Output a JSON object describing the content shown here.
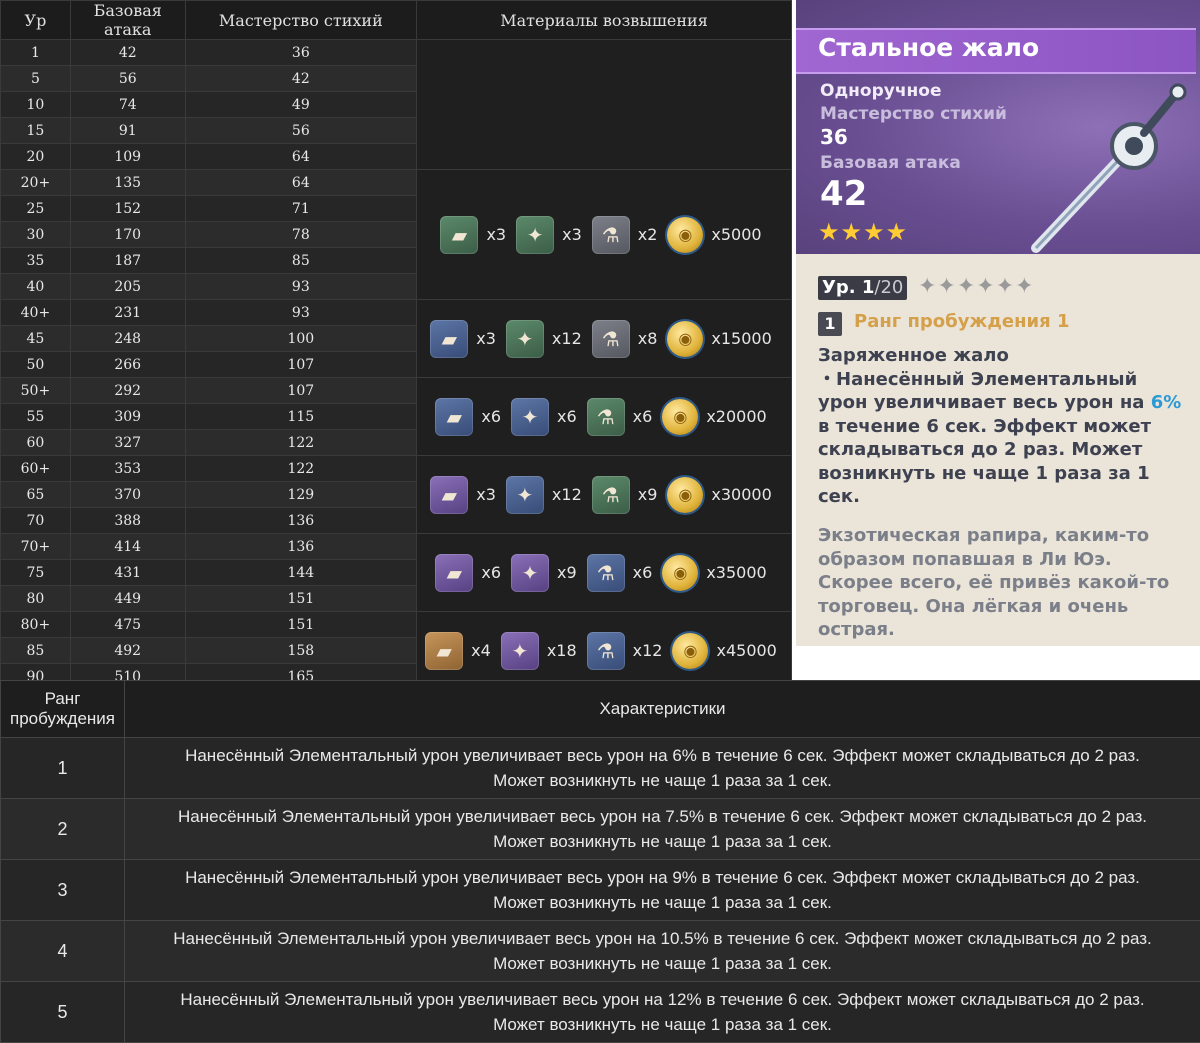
{
  "stats_table": {
    "headers": [
      "Ур",
      "Базовая атака",
      "Мастерство стихий",
      "Материалы возвышения"
    ],
    "rows": [
      {
        "level": "1",
        "atk": "42",
        "em": "36"
      },
      {
        "level": "5",
        "atk": "56",
        "em": "42"
      },
      {
        "level": "10",
        "atk": "74",
        "em": "49"
      },
      {
        "level": "15",
        "atk": "91",
        "em": "56"
      },
      {
        "level": "20",
        "atk": "109",
        "em": "64"
      },
      {
        "level": "20+",
        "atk": "135",
        "em": "64"
      },
      {
        "level": "25",
        "atk": "152",
        "em": "71"
      },
      {
        "level": "30",
        "atk": "170",
        "em": "78"
      },
      {
        "level": "35",
        "atk": "187",
        "em": "85"
      },
      {
        "level": "40",
        "atk": "205",
        "em": "93"
      },
      {
        "level": "40+",
        "atk": "231",
        "em": "93"
      },
      {
        "level": "45",
        "atk": "248",
        "em": "100"
      },
      {
        "level": "50",
        "atk": "266",
        "em": "107"
      },
      {
        "level": "50+",
        "atk": "292",
        "em": "107"
      },
      {
        "level": "55",
        "atk": "309",
        "em": "115"
      },
      {
        "level": "60",
        "atk": "327",
        "em": "122"
      },
      {
        "level": "60+",
        "atk": "353",
        "em": "122"
      },
      {
        "level": "65",
        "atk": "370",
        "em": "129"
      },
      {
        "level": "70",
        "atk": "388",
        "em": "136"
      },
      {
        "level": "70+",
        "atk": "414",
        "em": "136"
      },
      {
        "level": "75",
        "atk": "431",
        "em": "144"
      },
      {
        "level": "80",
        "atk": "449",
        "em": "151"
      },
      {
        "level": "80+",
        "atk": "475",
        "em": "151"
      },
      {
        "level": "85",
        "atk": "492",
        "em": "158"
      },
      {
        "level": "90",
        "atk": "510",
        "em": "165"
      }
    ],
    "materials": [
      {
        "items": [
          {
            "icon": "weapon-material-icon",
            "rarity": "r2",
            "glyph": "▰",
            "count": "x3"
          },
          {
            "icon": "elite-drop-icon",
            "rarity": "r2",
            "glyph": "✦",
            "count": "x3"
          },
          {
            "icon": "common-drop-icon",
            "rarity": "r1",
            "glyph": "⚗",
            "count": "x2"
          },
          {
            "icon": "mora-icon",
            "rarity": "mora",
            "glyph": "◉",
            "count": "x5000"
          }
        ]
      },
      {
        "items": [
          {
            "icon": "weapon-material-icon",
            "rarity": "r3",
            "glyph": "▰",
            "count": "x3"
          },
          {
            "icon": "elite-drop-icon",
            "rarity": "r2",
            "glyph": "✦",
            "count": "x12"
          },
          {
            "icon": "common-drop-icon",
            "rarity": "r1",
            "glyph": "⚗",
            "count": "x8"
          },
          {
            "icon": "mora-icon",
            "rarity": "mora",
            "glyph": "◉",
            "count": "x15000"
          }
        ]
      },
      {
        "items": [
          {
            "icon": "weapon-material-icon",
            "rarity": "r3",
            "glyph": "▰",
            "count": "x6"
          },
          {
            "icon": "elite-drop-icon",
            "rarity": "r3",
            "glyph": "✦",
            "count": "x6"
          },
          {
            "icon": "common-drop-icon",
            "rarity": "r2",
            "glyph": "⚗",
            "count": "x6"
          },
          {
            "icon": "mora-icon",
            "rarity": "mora",
            "glyph": "◉",
            "count": "x20000"
          }
        ]
      },
      {
        "items": [
          {
            "icon": "weapon-material-icon",
            "rarity": "r4",
            "glyph": "▰",
            "count": "x3"
          },
          {
            "icon": "elite-drop-icon",
            "rarity": "r3",
            "glyph": "✦",
            "count": "x12"
          },
          {
            "icon": "common-drop-icon",
            "rarity": "r2",
            "glyph": "⚗",
            "count": "x9"
          },
          {
            "icon": "mora-icon",
            "rarity": "mora",
            "glyph": "◉",
            "count": "x30000"
          }
        ]
      },
      {
        "items": [
          {
            "icon": "weapon-material-icon",
            "rarity": "r4",
            "glyph": "▰",
            "count": "x6"
          },
          {
            "icon": "elite-drop-icon",
            "rarity": "r4",
            "glyph": "✦",
            "count": "x9"
          },
          {
            "icon": "common-drop-icon",
            "rarity": "r3",
            "glyph": "⚗",
            "count": "x6"
          },
          {
            "icon": "mora-icon",
            "rarity": "mora",
            "glyph": "◉",
            "count": "x35000"
          }
        ]
      },
      {
        "items": [
          {
            "icon": "weapon-material-icon",
            "rarity": "r5",
            "glyph": "▰",
            "count": "x4"
          },
          {
            "icon": "elite-drop-icon",
            "rarity": "r4",
            "glyph": "✦",
            "count": "x18"
          },
          {
            "icon": "common-drop-icon",
            "rarity": "r3",
            "glyph": "⚗",
            "count": "x12"
          },
          {
            "icon": "mora-icon",
            "rarity": "mora",
            "glyph": "◉",
            "count": "x45000"
          }
        ]
      }
    ]
  },
  "weapon_card": {
    "name": "Стальное жало",
    "type": "Одноручное",
    "substat_label": "Мастерство стихий",
    "substat_value": "36",
    "atk_label": "Базовая атака",
    "atk_value": "42",
    "rarity_stars": "★★★★",
    "level_prefix": "Ур. 1",
    "level_max": "/20",
    "refine_stars": "✦✦✦✦✦✦",
    "refine_number": "1",
    "refine_label": "Ранг пробуждения 1",
    "passive_name": "Заряженное жало",
    "passive_text_1": "・Нанесённый Элементальный урон увеличивает весь урон на ",
    "passive_highlight": "6%",
    "passive_text_2": " в течение 6 сек. Эффект может складываться до 2 раз. Может возникнуть не чаще 1 раза за 1 сек.",
    "lore": "Экзотическая рапира, каким-то образом попавшая в Ли Юэ. Скорее всего, её привёз какой-то торговец. Она лёгкая и очень острая.",
    "colors": {
      "title_bar": "#9a60cc",
      "highlight": "#2b9ad6",
      "refine_label": "#d5a04a",
      "star": "#ffcc33"
    }
  },
  "refine_table": {
    "header_rank": "Ранг пробуждения",
    "header_desc": "Характеристики",
    "rows": [
      {
        "rank": "1",
        "line1": "Нанесённый Элементальный урон увеличивает весь урон на 6% в течение 6 сек. Эффект может складываться до 2 раз.",
        "line2": "Может возникнуть не чаще 1 раза за 1 сек."
      },
      {
        "rank": "2",
        "line1": "Нанесённый Элементальный урон увеличивает весь урон на 7.5% в течение 6 сек. Эффект может складываться до 2 раз.",
        "line2": "Может возникнуть не чаще 1 раза за 1 сек."
      },
      {
        "rank": "3",
        "line1": "Нанесённый Элементальный урон увеличивает весь урон на 9% в течение 6 сек. Эффект может складываться до 2 раз.",
        "line2": "Может возникнуть не чаще 1 раза за 1 сек."
      },
      {
        "rank": "4",
        "line1": "Нанесённый Элементальный урон увеличивает весь урон на 10.5% в течение 6 сек. Эффект может складываться до 2 раз.",
        "line2": "Может возникнуть не чаще 1 раза за 1 сек."
      },
      {
        "rank": "5",
        "line1": "Нанесённый Элементальный урон увеличивает весь урон на 12% в течение 6 сек. Эффект может складываться до 2 раз.",
        "line2": "Может возникнуть не чаще 1 раза за 1 сек."
      }
    ]
  }
}
